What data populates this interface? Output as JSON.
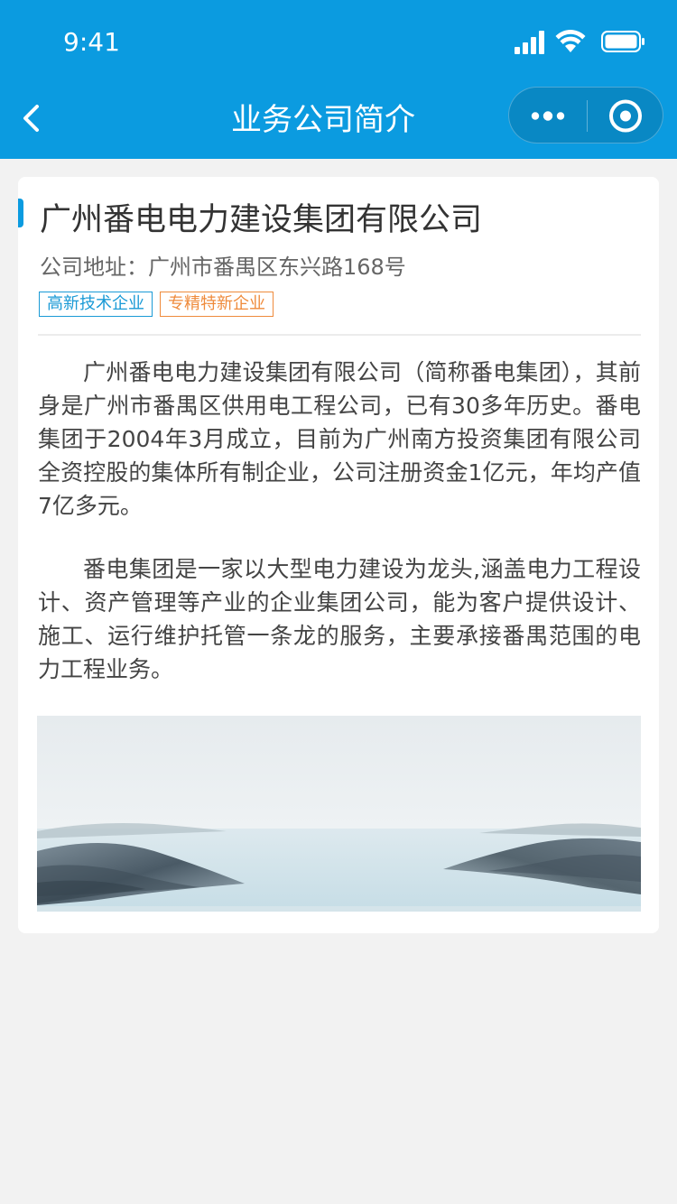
{
  "status_bar": {
    "time": "9:41",
    "icons": [
      "signal-icon",
      "wifi-icon",
      "battery-icon"
    ]
  },
  "nav": {
    "back_icon": "chevron-left-icon",
    "title": "业务公司简介",
    "more_icon": "more-dots-icon",
    "close_icon": "target-close-icon"
  },
  "company": {
    "name": "广州番电电力建设集团有限公司",
    "address": "公司地址：广州市番禺区东兴路168号",
    "tags": [
      {
        "label": "高新技术企业",
        "color": "#1a9ad6"
      },
      {
        "label": "专精特新企业",
        "color": "#ef8b3c"
      }
    ],
    "paragraphs": [
      "广州番电电力建设集团有限公司（简称番电集团），其前身是广州市番禺区供用电工程公司，已有30多年历史。番电集团于2004年3月成立，目前为广州南方投资集团有限公司全资控股的集体所有制企业，公司注册资金1亿元，年均产值7亿多元。",
      "番电集团是一家以大型电力建设为龙头,涵盖电力工程设计、资产管理等产业的企业集团公司，能为客户提供设计、施工、运行维护托管一条龙的服务，主要承接番禺范围的电力工程业务。"
    ]
  },
  "colors": {
    "header_bg": "#0b9be0",
    "page_bg": "#f2f2f2",
    "card_bg": "#ffffff"
  }
}
